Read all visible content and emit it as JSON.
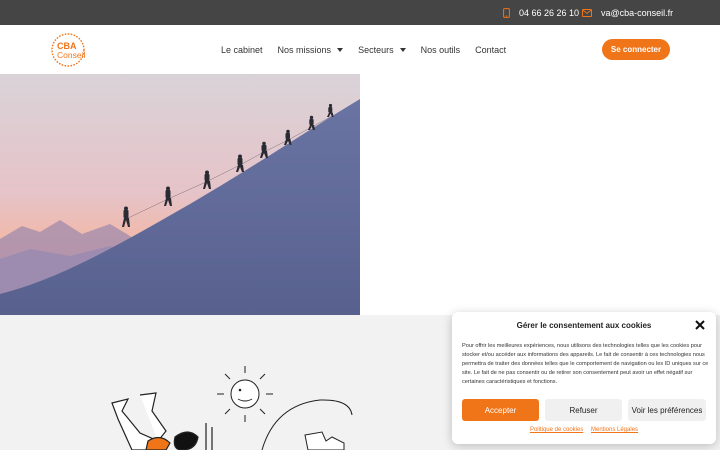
{
  "topbar": {
    "phone": "04 66 26 26 10",
    "email": "va@cba-conseil.fr",
    "phone_icon": "phone-icon",
    "mail_icon": "envelope-icon"
  },
  "header": {
    "logo": {
      "line1": "CBA",
      "line2": "Conseil"
    },
    "nav": [
      {
        "label": "Le cabinet",
        "has_dropdown": false
      },
      {
        "label": "Nos missions",
        "has_dropdown": true
      },
      {
        "label": "Secteurs",
        "has_dropdown": true
      },
      {
        "label": "Nos outils",
        "has_dropdown": false
      },
      {
        "label": "Contact",
        "has_dropdown": false
      }
    ],
    "login_label": "Se connecter"
  },
  "cookie": {
    "title": "Gérer le consentement aux cookies",
    "text": "Pour offrir les meilleures expériences, nous utilisons des technologies telles que les cookies pour stocker et/ou accéder aux informations des appareils. Le fait de consentir à ces technologies nous permettra de traiter des données telles que le comportement de navigation ou les ID uniques sur ce site. Le fait de ne pas consentir ou de retirer son consentement peut avoir un effet négatif sur certaines caractéristiques et fonctions.",
    "accept": "Accepter",
    "refuse": "Refuser",
    "prefs": "Voir les préférences",
    "link_policy": "Politique de cookies",
    "link_legal": "Mentions Légales"
  },
  "colors": {
    "accent": "#f07418",
    "topbar": "#454545",
    "lower_bg": "#f2f2f2"
  }
}
